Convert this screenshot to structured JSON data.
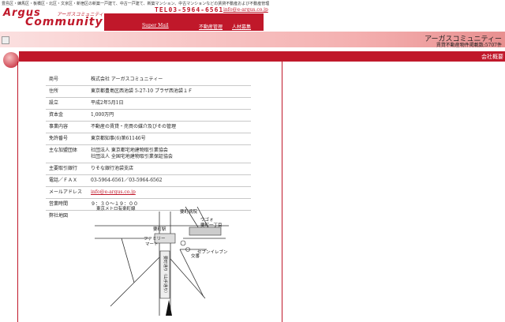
{
  "header": {
    "seo_text": "豊島区・練馬区・板橋区・北区・文京区・新宿区の新築一戸建て、中古一戸建て、新築マンション、中古マンションなどの賃貸不動産および不動産管理",
    "logo_line1": "Argus",
    "logo_line2": "Community",
    "logo_kana": "アーガスコミュニティー",
    "tel": "TEL03-5964-6561",
    "email": "info@e-argus.co.jp"
  },
  "nav": {
    "super_mail": "Super Mail",
    "real_estate_mgmt": "不動産管理",
    "recruiting": "人材募集"
  },
  "banner": {
    "company_name": "アーガスコミュニティー",
    "listing_count": "賃貸不動産物件掲載数:5707件"
  },
  "section": {
    "title": "会社概要"
  },
  "company": {
    "rows": [
      {
        "label": "商号",
        "value": "株式会社 アーガスコミュニティー"
      },
      {
        "label": "住所",
        "value": "東京都豊島区西池袋 5-27-10 プラザ西池袋１Ｆ"
      },
      {
        "label": "設立",
        "value": "平成2年5月1日"
      },
      {
        "label": "資本金",
        "value": "1,000万円"
      },
      {
        "label": "事業内容",
        "value": "不動産の賃貸・売買の媒介及びその管理"
      },
      {
        "label": "免許番号",
        "value": "東京都知事(6)第61146号"
      },
      {
        "label": "主な加盟団体",
        "value": "社団法人 東京都宅地建物取引業協会",
        "value2": "社団法人 全国宅地建物取引業保証協会"
      },
      {
        "label": "主要取引銀行",
        "value": "りそな銀行池袋支店"
      },
      {
        "label": "電話／ＦＡＸ",
        "value": "03-5964-6561／03-5964-6562"
      },
      {
        "label": "メールアドレス",
        "value": "info@e-argus.co.jp"
      },
      {
        "label": "営業時間",
        "value": "９：３０～１９：００"
      },
      {
        "label": "弊社地図",
        "value": ""
      }
    ]
  },
  "map": {
    "station_metro": "東京メトロ有楽町線",
    "hospital": "要町病院",
    "ugo": "ウゴォ",
    "kanamecho1": "要町一丁目",
    "station": "要町駅",
    "familymart": "ファミリー",
    "familymart2": "マート",
    "seven": "セブンイレブン",
    "koban": "交番",
    "road": "要町通り（山手通り）"
  }
}
